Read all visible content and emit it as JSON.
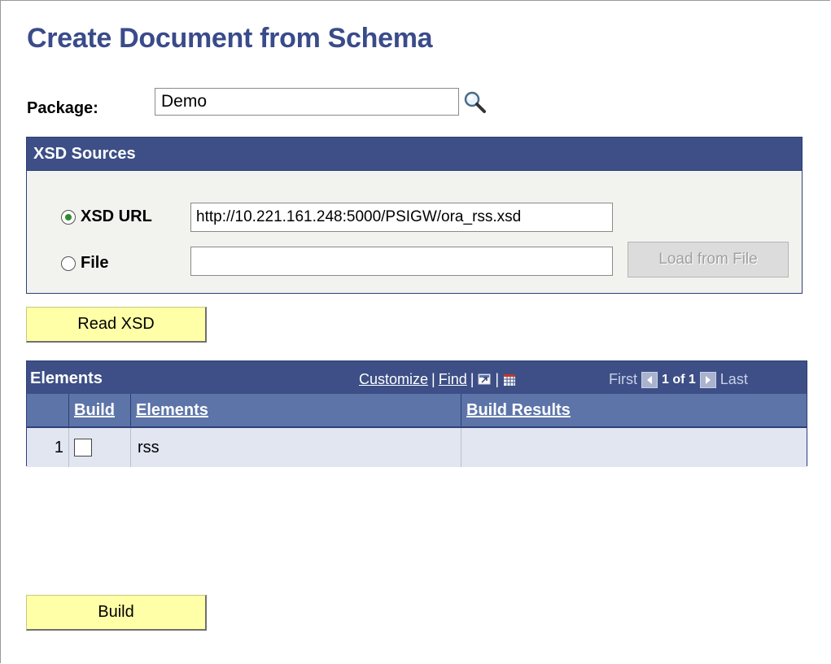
{
  "page": {
    "title": "Create Document from Schema"
  },
  "package": {
    "label": "Package:",
    "value": "Demo"
  },
  "xsd_sources": {
    "header": "XSD Sources",
    "url_option": {
      "label": "XSD URL",
      "checked": true,
      "value": "http://10.221.161.248:5000/PSIGW/ora_rss.xsd"
    },
    "file_option": {
      "label": "File",
      "checked": false,
      "value": ""
    },
    "load_button": "Load from File"
  },
  "read_button": "Read XSD",
  "elements_grid": {
    "title": "Elements",
    "customize": "Customize",
    "find": "Find",
    "separator": "|",
    "first": "First",
    "page_info": "1 of 1",
    "last": "Last",
    "columns": {
      "build": "Build",
      "elements": "Elements",
      "results": "Build Results"
    },
    "rows": [
      {
        "num": "1",
        "build": false,
        "element": "rss",
        "result": ""
      }
    ]
  },
  "build_button": "Build",
  "colors": {
    "header_bg": "#3d4f86",
    "column_header_bg": "#5c74a8",
    "button_bg": "#ffffa8",
    "title": "#3a4b8a",
    "row_bg": "#e1e6f0"
  }
}
